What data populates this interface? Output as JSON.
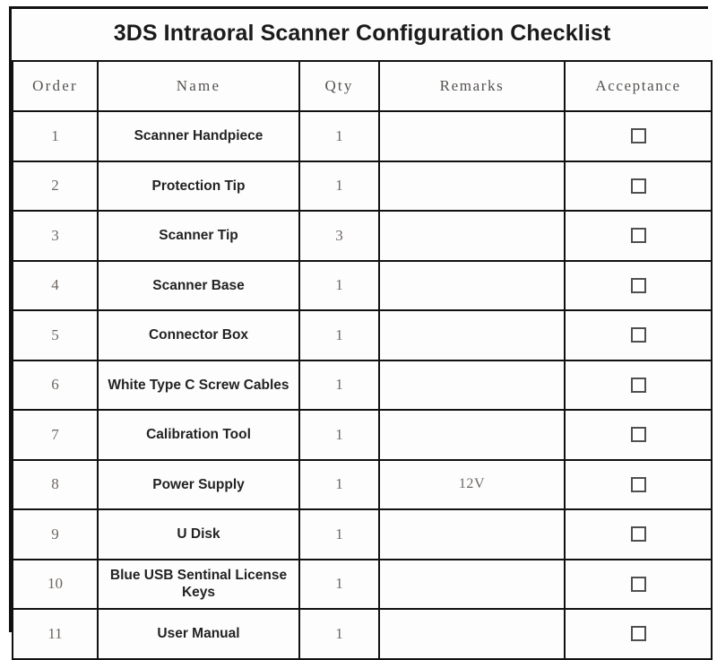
{
  "document": {
    "title": "3DS Intraoral Scanner Configuration Checklist"
  },
  "table": {
    "columns": {
      "order": "Order",
      "name": "Name",
      "qty": "Qty",
      "remarks": "Remarks",
      "acceptance": "Acceptance"
    },
    "rows": [
      {
        "order": "1",
        "name": "Scanner Handpiece",
        "qty": "1",
        "remarks": "",
        "acceptance": "unchecked-checkbox"
      },
      {
        "order": "2",
        "name": "Protection Tip",
        "qty": "1",
        "remarks": "",
        "acceptance": "unchecked-checkbox"
      },
      {
        "order": "3",
        "name": "Scanner Tip",
        "qty": "3",
        "remarks": "",
        "acceptance": "unchecked-checkbox"
      },
      {
        "order": "4",
        "name": "Scanner Base",
        "qty": "1",
        "remarks": "",
        "acceptance": "unchecked-checkbox"
      },
      {
        "order": "5",
        "name": "Connector Box",
        "qty": "1",
        "remarks": "",
        "acceptance": "unchecked-checkbox"
      },
      {
        "order": "6",
        "name": "White Type C Screw Cables",
        "qty": "1",
        "remarks": "",
        "acceptance": "unchecked-checkbox"
      },
      {
        "order": "7",
        "name": "Calibration Tool",
        "qty": "1",
        "remarks": "",
        "acceptance": "unchecked-checkbox"
      },
      {
        "order": "8",
        "name": "Power Supply",
        "qty": "1",
        "remarks": "12V",
        "acceptance": "unchecked-checkbox"
      },
      {
        "order": "9",
        "name": "U Disk",
        "qty": "1",
        "remarks": "",
        "acceptance": "unchecked-checkbox"
      },
      {
        "order": "10",
        "name": "Blue USB Sentinal License Keys",
        "qty": "1",
        "remarks": "",
        "acceptance": "unchecked-checkbox"
      },
      {
        "order": "11",
        "name": "User Manual",
        "qty": "1",
        "remarks": "",
        "acceptance": "unchecked-checkbox"
      }
    ]
  },
  "colors": {
    "grid_line": "#111111",
    "title_text": "#1b1b1b",
    "header_text": "#55524f",
    "name_text": "#232323",
    "muted_text": "#6d6763",
    "checkbox_border": "#4f4f4f",
    "page_background": "#ffffff",
    "cell_background": "#fdfdfd"
  }
}
